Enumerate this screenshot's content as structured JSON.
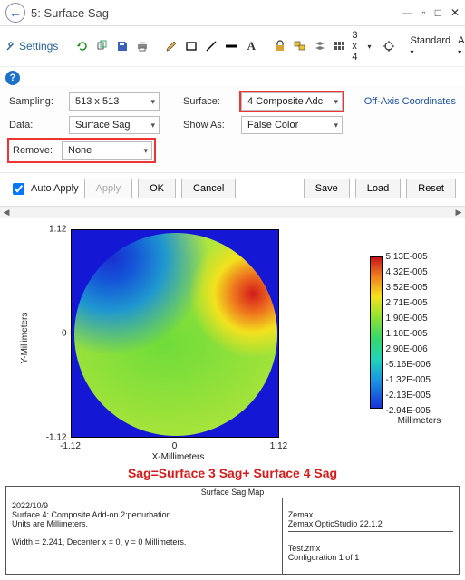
{
  "title": "5: Surface Sag",
  "toolbar": {
    "settings": "Settings",
    "grid": "3 x 4",
    "standard": "Standard",
    "automatic": "Automatic"
  },
  "controls": {
    "sampling_label": "Sampling:",
    "sampling_value": "513 x 513",
    "surface_label": "Surface:",
    "surface_value": "4 Composite Adc",
    "offaxis": "Off-Axis Coordinates",
    "data_label": "Data:",
    "data_value": "Surface Sag",
    "showas_label": "Show As:",
    "showas_value": "False Color",
    "remove_label": "Remove:",
    "remove_value": "None"
  },
  "buttons": {
    "auto_apply": "Auto Apply",
    "apply": "Apply",
    "ok": "OK",
    "cancel": "Cancel",
    "save": "Save",
    "load": "Load",
    "reset": "Reset"
  },
  "chart_data": {
    "type": "heatmap",
    "xlabel": "X-Millimeters",
    "ylabel": "Y-Millimeters",
    "xlim": [
      -1.12,
      1.12
    ],
    "ylim": [
      -1.12,
      1.12
    ],
    "xticks": [
      "-1.12",
      "0",
      "1.12"
    ],
    "yticks": [
      "1.12",
      "0",
      "-1.12"
    ],
    "colorbar_unit": "Millimeters",
    "colorbar_labels": [
      "5.13E-005",
      "4.32E-005",
      "3.52E-005",
      "2.71E-005",
      "1.90E-005",
      "1.10E-005",
      "2.90E-006",
      "-5.16E-006",
      "-1.32E-005",
      "-2.13E-005",
      "-2.94E-005"
    ]
  },
  "annotation": "Sag=Surface 3 Sag+ Surface 4 Sag",
  "footer": {
    "header": "Surface Sag Map",
    "left": "2022/10/9\nSurface 4: Composite Add-on 2:perturbation\nUnits are Millimeters.\n\nWidth = 2.241, Decenter x = 0, y = 0 Millimeters.",
    "right_top": "Zemax\nZemax OpticStudio 22.1.2",
    "right_bot": "Test.zmx\nConfiguration 1 of 1"
  }
}
